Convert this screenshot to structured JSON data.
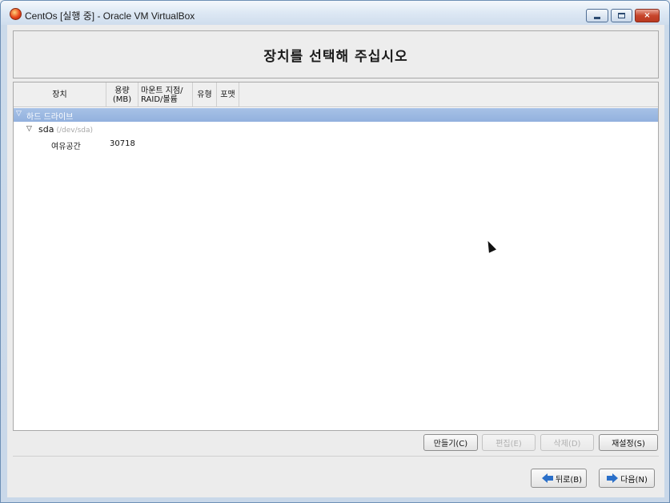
{
  "window": {
    "title": "CentOs [실행 중] - Oracle VM VirtualBox",
    "app_icon": "virtualbox-icon",
    "controls": {
      "minimize": "minimize-icon",
      "maximize": "maximize-icon",
      "close": "×"
    }
  },
  "header": {
    "title": "장치를 선택해 주십시오"
  },
  "table": {
    "columns": [
      {
        "label": "장치"
      },
      {
        "label": "용량\n(MB)"
      },
      {
        "label": "마운트 지점/\nRAID/볼륨"
      },
      {
        "label": "유형"
      },
      {
        "label": "포맷"
      }
    ],
    "group": {
      "label": "하드 드라이브",
      "expanded": true
    },
    "disk": {
      "name": "sda",
      "path": "(/dev/sda)",
      "expanded": true
    },
    "free": {
      "label": "여유공간",
      "size": "30718"
    }
  },
  "actions": {
    "create": "만들기(C)",
    "edit": "편집(E)",
    "delete": "삭제(D)",
    "reset": "재설정(S)"
  },
  "nav": {
    "back": "뒤로(B)",
    "next": "다음(N)"
  },
  "colors": {
    "selection": "#92b1de",
    "accent_arrow": "#2a6fc9"
  }
}
